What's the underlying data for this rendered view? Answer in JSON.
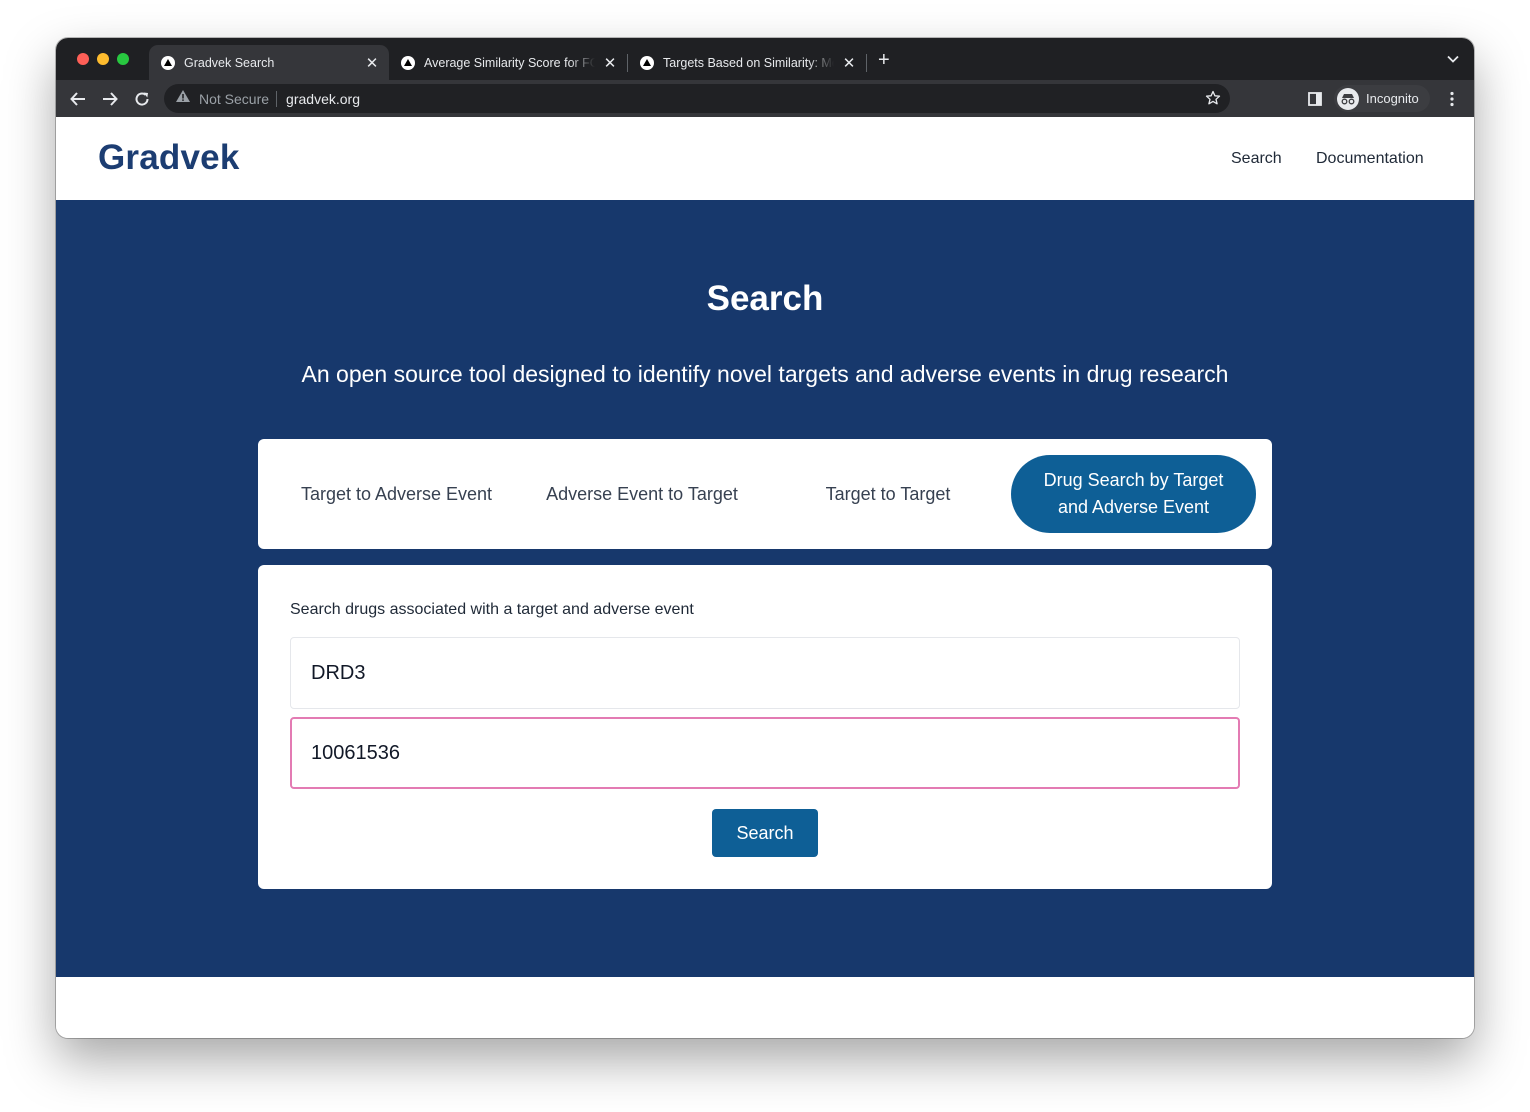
{
  "browser": {
    "tabs": [
      {
        "title": "Gradvek Search",
        "active": true
      },
      {
        "title": "Average Similarity Score for FGF",
        "active": false
      },
      {
        "title": "Targets Based on Similarity: Mo",
        "active": false
      }
    ],
    "new_tab_icon": "plus-icon",
    "tab_menu_icon": "chevron-down-icon",
    "nav_icons": [
      "back-arrow-icon",
      "forward-arrow-icon",
      "reload-icon"
    ],
    "security_label": "Not Secure",
    "url": "gradvek.org",
    "profile_label": "Incognito",
    "menu_icon": "kebab-menu-icon"
  },
  "site": {
    "logo": "Gradvek",
    "nav": [
      "Search",
      "Documentation"
    ],
    "brand_color": "#1c3d72"
  },
  "hero": {
    "title": "Search",
    "subtitle": "An open source tool designed to identify novel targets and adverse events in drug research",
    "background_color": "#17386c"
  },
  "mode_tabs": [
    {
      "label": "Target to Adverse Event",
      "active": false
    },
    {
      "label": "Adverse Event to Target",
      "active": false
    },
    {
      "label": "Target to Target",
      "active": false
    },
    {
      "label": "Drug Search by Target and Adverse Event",
      "active": true
    }
  ],
  "form": {
    "label": "Search drugs associated with a target and adverse event",
    "target_value": "DRD3",
    "adverse_event_value": "10061536",
    "submit_label": "Search",
    "accent_color": "#0e5f96",
    "focus_color": "#e37bb3"
  }
}
